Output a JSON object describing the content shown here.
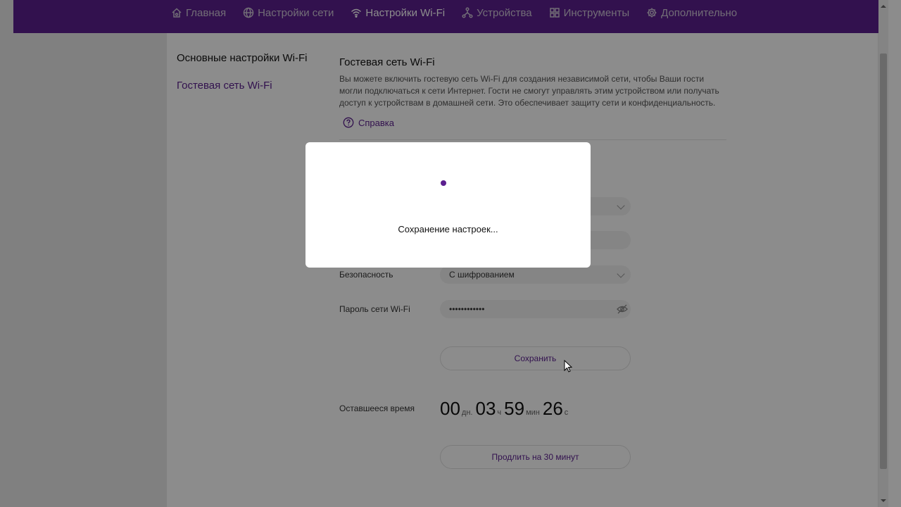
{
  "nav": {
    "items": [
      {
        "label": "Главная",
        "icon": "home-icon",
        "active": false
      },
      {
        "label": "Настройки сети",
        "icon": "globe-icon",
        "active": false
      },
      {
        "label": "Настройки Wi-Fi",
        "icon": "wifi-icon",
        "active": true
      },
      {
        "label": "Устройства",
        "icon": "devices-icon",
        "active": false
      },
      {
        "label": "Инструменты",
        "icon": "tools-icon",
        "active": false
      },
      {
        "label": "Дополнительно",
        "icon": "gear-icon",
        "active": false
      }
    ]
  },
  "sidebar": {
    "items": [
      {
        "label": "Основные настройки Wi-Fi",
        "active": false
      },
      {
        "label": "Гостевая сеть Wi-Fi",
        "active": true
      }
    ]
  },
  "content": {
    "title": "Гостевая сеть Wi-Fi",
    "description": "Вы можете включить гостевую сеть Wi-Fi для создания независимой сети, чтобы Ваши гости могли подключаться к сети Интернет. Гости не смогут управлять этим устройством или получать доступ к устройствам в домашней сети. Это обеспечивает защиту сети и конфиденциальность.",
    "help_label": "Справка",
    "security": {
      "label": "Безопасность",
      "value": "С шифрованием"
    },
    "password": {
      "label": "Пароль сети Wi-Fi",
      "value": "••••••••••••"
    },
    "save_label": "Сохранить",
    "remaining": {
      "label": "Оставшееся время",
      "days": "00",
      "days_unit": "дн.",
      "hours": "03",
      "hours_unit": "ч",
      "minutes": "59",
      "minutes_unit": "мин",
      "seconds": "26",
      "seconds_unit": "с"
    },
    "extend_label": "Продлить на 30 минут"
  },
  "modal": {
    "message": "Сохранение настроек..."
  },
  "colors": {
    "brand": "#5b1f8f",
    "overlay": "rgba(0,0,0,0.45)"
  }
}
